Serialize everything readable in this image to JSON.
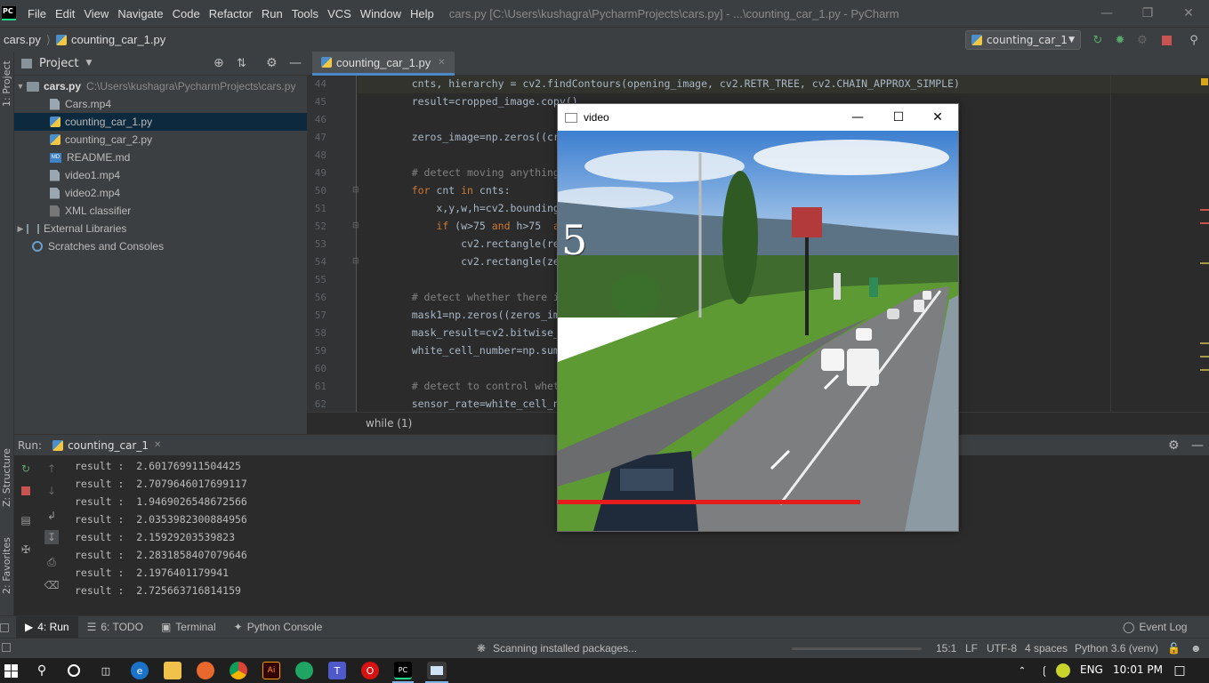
{
  "window": {
    "title": "cars.py [C:\\Users\\kushagra\\PycharmProjects\\cars.py] - ...\\counting_car_1.py - PyCharm",
    "logo": "PC"
  },
  "menu": [
    "File",
    "Edit",
    "View",
    "Navigate",
    "Code",
    "Refactor",
    "Run",
    "Tools",
    "VCS",
    "Window",
    "Help"
  ],
  "nav": {
    "project": "cars.py",
    "file": "counting_car_1.py",
    "run_config": "counting_car_1"
  },
  "left_strip": {
    "project_label": "1: Project",
    "structure_label": "Z: Structure",
    "favorites_label": "2: Favorites"
  },
  "project_panel": {
    "title": "Project",
    "root_name": "cars.py",
    "root_path": "C:\\Users\\kushagra\\PycharmProjects\\cars.py",
    "files": [
      "Cars.mp4",
      "counting_car_1.py",
      "counting_car_2.py",
      "README.md",
      "video1.mp4",
      "video2.mp4",
      "XML classifier"
    ],
    "external_libraries": "External Libraries",
    "scratches": "Scratches and Consoles"
  },
  "editor": {
    "tab": "counting_car_1.py",
    "line_numbers": [
      "44",
      "45",
      "46",
      "47",
      "48",
      "49",
      "50",
      "51",
      "52",
      "53",
      "54",
      "55",
      "56",
      "57",
      "58",
      "59",
      "60",
      "61",
      "62"
    ],
    "lines": [
      "    cnts, hierarchy = cv2.findContours(opening_image, cv2.RETR_TREE, cv2.CHAIN_APPROX_SIMPLE)",
      "    result=cropped_image.copy()",
      "",
      "    zeros_image=np.zeros((cropp",
      "",
      "    # detect moving anything wi",
      "    for cnt in cnts:",
      "        x,y,w,h=cv2.boundingRect",
      "        if (w>75 and h>75  and w",
      "            cv2.rectangle(resul",
      "            cv2.rectangle(zeros",
      "",
      "    # detect whether there is c",
      "    mask1=np.zeros((zeros_image",
      "    mask_result=cv2.bitwise_or(",
      "    white_cell_number=np.sum(ma",
      "",
      "    # detect to control whether",
      "    sensor_rate=white_cell_numbe"
    ],
    "breadcrumb": "while (1)"
  },
  "run_panel": {
    "label": "Run:",
    "tab": "counting_car_1",
    "output": [
      "result :  2.601769911504425",
      "result :  2.7079646017699117",
      "result :  1.9469026548672566",
      "result :  2.0353982300884956",
      "result :  2.15929203539823",
      "result :  2.2831858407079646",
      "result :  2.1976401179941",
      "result :  2.725663716814159"
    ]
  },
  "bottom_tabs": [
    "4: Run",
    "6: TODO",
    "Terminal",
    "Python Console"
  ],
  "event_log": "Event Log",
  "status": {
    "message": "Scanning installed packages...",
    "position": "15:1",
    "line_sep": "LF",
    "encoding": "UTF-8",
    "indent": "4 spaces",
    "interpreter": "Python 3.6 (venv)"
  },
  "video_window": {
    "title": "video",
    "counter": "5"
  },
  "taskbar": {
    "lang": "ENG",
    "time": "10:01 PM"
  }
}
